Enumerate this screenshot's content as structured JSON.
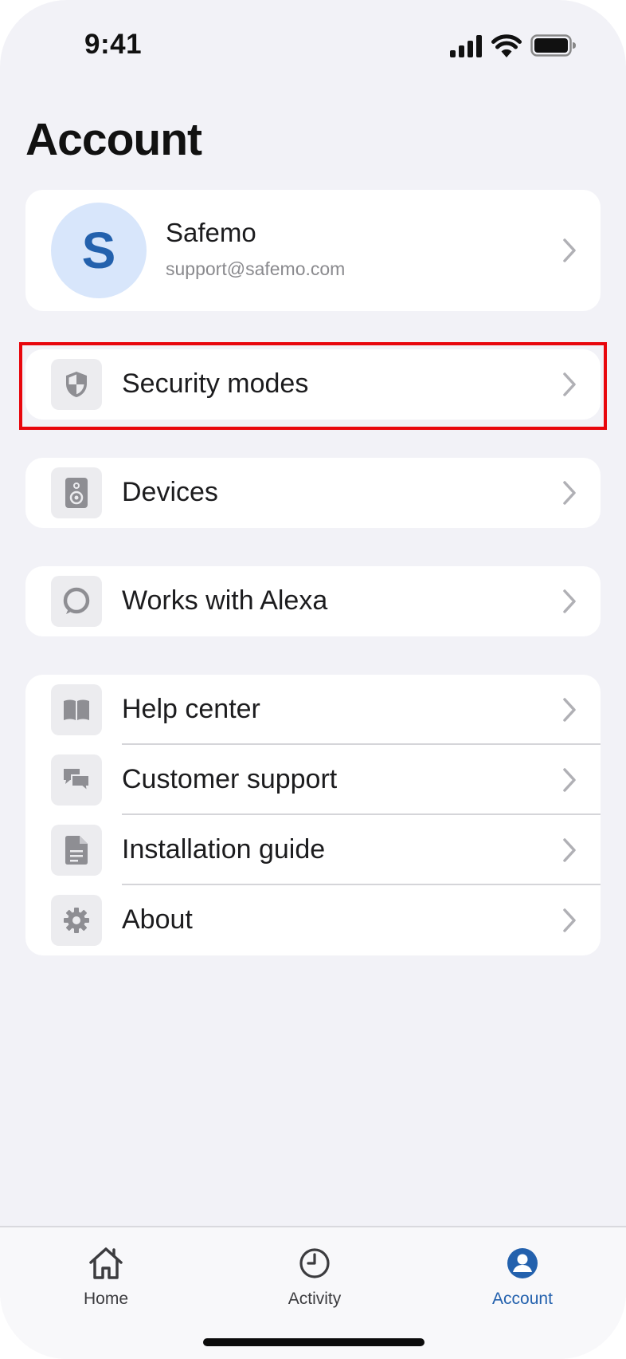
{
  "status_bar": {
    "time": "9:41"
  },
  "page_title": "Account",
  "profile": {
    "avatar_letter": "S",
    "name": "Safemo",
    "email": "support@safemo.com"
  },
  "menu": {
    "security_modes": {
      "label": "Security modes",
      "icon": "shield-icon"
    },
    "devices": {
      "label": "Devices",
      "icon": "speaker-icon"
    },
    "alexa": {
      "label": "Works with Alexa",
      "icon": "alexa-ring-icon"
    },
    "help_center": {
      "label": "Help center",
      "icon": "book-icon"
    },
    "customer_support": {
      "label": "Customer support",
      "icon": "chat-bubbles-icon"
    },
    "installation_guide": {
      "label": "Installation guide",
      "icon": "document-icon"
    },
    "about": {
      "label": "About",
      "icon": "gear-icon"
    }
  },
  "tabs": {
    "home": {
      "label": "Home",
      "icon": "home-icon"
    },
    "activity": {
      "label": "Activity",
      "icon": "clock-icon"
    },
    "account": {
      "label": "Account",
      "icon": "account-icon",
      "active": true
    }
  },
  "colors": {
    "accent": "#2361ad",
    "background": "#f2f2f7",
    "card": "#ffffff",
    "icon_gray": "#8e8e93",
    "highlight": "#e8070d"
  }
}
